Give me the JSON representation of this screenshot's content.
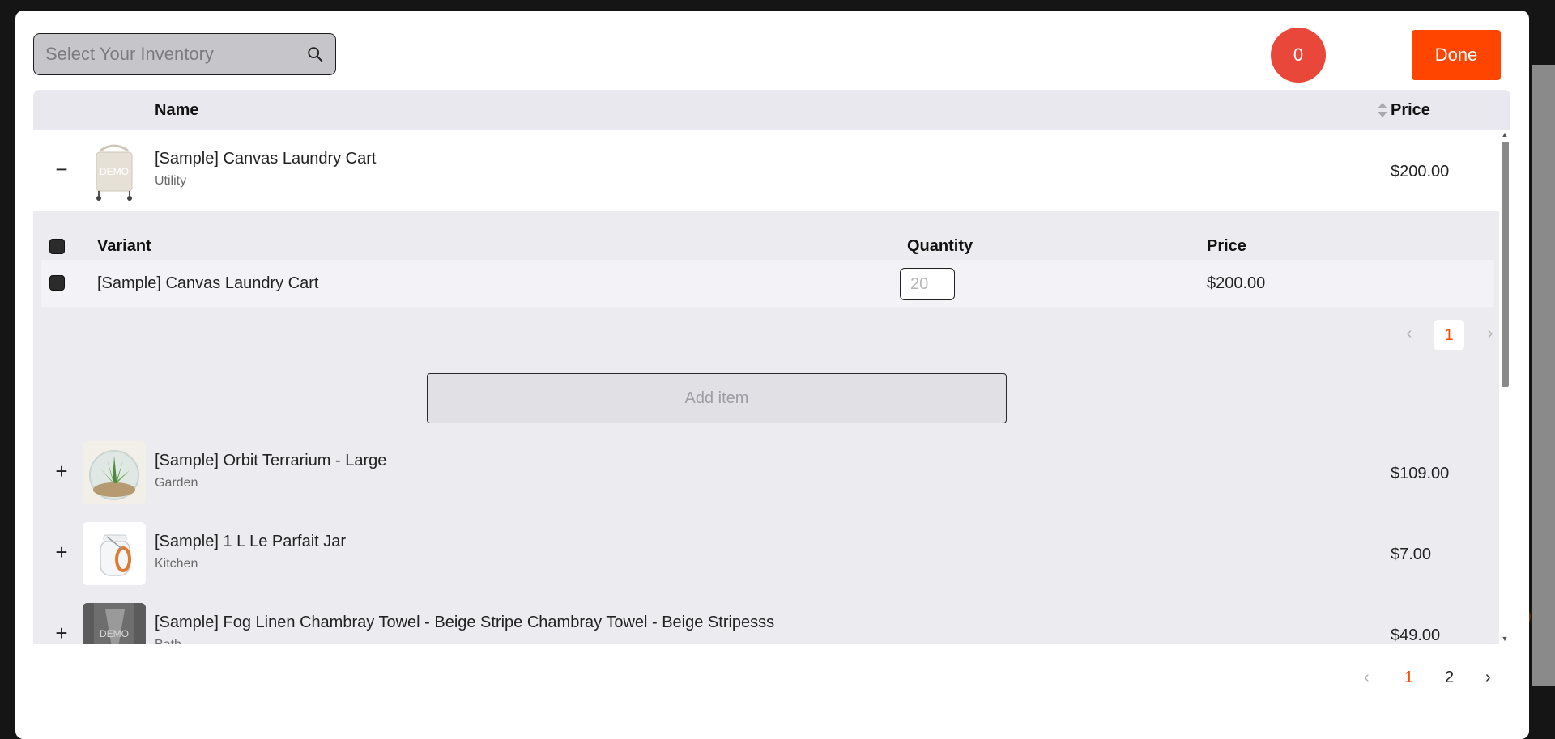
{
  "search": {
    "placeholder": "Select Your Inventory"
  },
  "selected_count": "0",
  "done_label": "Done",
  "table": {
    "headers": {
      "name": "Name",
      "price": "Price"
    },
    "rows": [
      {
        "toggle": "−",
        "name": "[Sample] Canvas Laundry Cart",
        "category": "Utility",
        "price": "$200.00",
        "thumb_text": "DEMO",
        "expanded": true
      },
      {
        "toggle": "+",
        "name": "[Sample] Orbit Terrarium - Large",
        "category": "Garden",
        "price": "$109.00"
      },
      {
        "toggle": "+",
        "name": "[Sample] 1 L Le Parfait Jar",
        "category": "Kitchen",
        "price": "$7.00"
      },
      {
        "toggle": "+",
        "name": "[Sample] Fog Linen Chambray Towel - Beige Stripe Chambray Towel - Beige Stripesss",
        "category": "Bath",
        "price": "$49.00",
        "thumb_text": "DEMO"
      }
    ]
  },
  "variants": {
    "headers": {
      "variant": "Variant",
      "quantity": "Quantity",
      "price": "Price"
    },
    "rows": [
      {
        "name": "[Sample] Canvas Laundry Cart",
        "quantity_placeholder": "20",
        "price": "$200.00"
      }
    ],
    "pagination": {
      "prev": "‹",
      "current": "1",
      "next": "›"
    },
    "add_item_label": "Add item"
  },
  "pagination": {
    "prev": "‹",
    "pages": [
      "1",
      "2"
    ],
    "next": "›"
  },
  "colors": {
    "accent": "#ff4500",
    "counter_badge": "#e9473a",
    "header_bg": "#e8e8ee"
  }
}
